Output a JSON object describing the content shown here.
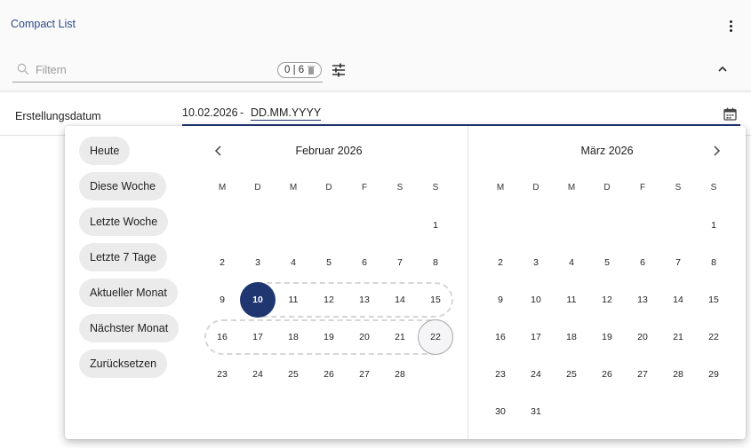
{
  "header": {
    "title": "Compact List"
  },
  "filter": {
    "placeholder": "Filtern",
    "count": "0 | 6"
  },
  "row": {
    "label": "Erstellungsdatum",
    "date_from": "10.02.2026",
    "separator": "-",
    "date_to": "DD.MM.YYYY"
  },
  "presets": [
    "Heute",
    "Diese Woche",
    "Letzte Woche",
    "Letzte 7 Tage",
    "Aktueller Monat",
    "Nächster Monat",
    "Zurücksetzen"
  ],
  "weekdays": [
    "M",
    "D",
    "M",
    "D",
    "F",
    "S",
    "S"
  ],
  "months": [
    {
      "title": "Februar 2026",
      "weeks": [
        [
          "",
          "",
          "",
          "",
          "",
          "",
          "1"
        ],
        [
          "2",
          "3",
          "4",
          "5",
          "6",
          "7",
          "8"
        ],
        [
          "9",
          "10",
          "11",
          "12",
          "13",
          "14",
          "15"
        ],
        [
          "16",
          "17",
          "18",
          "19",
          "20",
          "21",
          "22"
        ],
        [
          "23",
          "24",
          "25",
          "26",
          "27",
          "28",
          ""
        ]
      ],
      "selected": "10",
      "hovered": "22"
    },
    {
      "title": "März 2026",
      "weeks": [
        [
          "",
          "",
          "",
          "",
          "",
          "",
          "1"
        ],
        [
          "2",
          "3",
          "4",
          "5",
          "6",
          "7",
          "8"
        ],
        [
          "9",
          "10",
          "11",
          "12",
          "13",
          "14",
          "15"
        ],
        [
          "16",
          "17",
          "18",
          "19",
          "20",
          "21",
          "22"
        ],
        [
          "23",
          "24",
          "25",
          "26",
          "27",
          "28",
          "29"
        ],
        [
          "30",
          "31",
          "",
          "",
          "",
          "",
          ""
        ]
      ]
    }
  ],
  "colors": {
    "accent": "#1f3670",
    "title": "#2b4a8a",
    "chip": "#ebebeb"
  },
  "icons": [
    "kebab-menu-icon",
    "search-icon",
    "trash-icon",
    "sliders-icon",
    "chevron-up-icon",
    "calendar-icon",
    "chevron-left-icon",
    "chevron-right-icon"
  ]
}
